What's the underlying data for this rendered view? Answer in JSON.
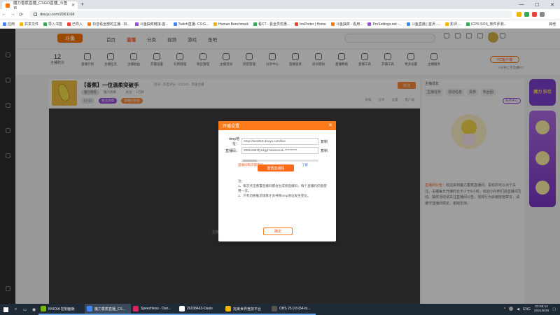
{
  "browser": {
    "tab_title": "魔力香蕉直播_CSGO直播_斗鱼直...",
    "url": "douyu.com/2061168",
    "bookmarks": [
      "应用",
      "共享文件",
      "导入书签",
      "已导入",
      "抖音看全部的主播 - 抖...",
      "斗鱼抽奖链接-首...",
      "Twitch直播- CS:G...",
      "Human Benchmark",
      "看CT - 看全员优惠...",
      "InsPorter | Home",
      "斗鱼抽奖 - 看用...",
      "ProSettings.net -...",
      "斗鱼直播 | 首页 -...",
      "影评·...",
      "ICPS SOS_软件评测..."
    ],
    "bookmarks_more": "其他"
  },
  "header": {
    "logo": "斗鱼",
    "nav": [
      "首页",
      "直播",
      "分类",
      "视频",
      "游戏",
      "鱼吧"
    ]
  },
  "toolbar": {
    "count": "12",
    "count_label": "主播积分",
    "items": [
      "直播计划",
      "主播任务",
      "主播收益",
      "开播设置",
      "礼物管理",
      "粉丝管理",
      "主播活动",
      "房管管理",
      "分享中心",
      "直播道具",
      "房间装扮",
      "直播数据",
      "直播工具",
      "开播工具",
      "更多设置",
      "主播服务"
    ],
    "pc_client": "PC客户端",
    "pc_sub": "1分钟上手直播PC"
  },
  "room": {
    "title": "【香蕉】一位温柔突破手",
    "subtitle": "房间 · 热度评分 · CS:GO · 等级主播",
    "meta": [
      "魔力香蕉",
      "·",
      "关注",
      "1万粉"
    ],
    "tags": [
      "LV 11",
      "粉丝勋章",
      "直播间等级"
    ],
    "cover_label": "魔力香蕉",
    "follow": "关注",
    "tools": [
      "举报",
      "分享",
      "设置",
      "客户端"
    ]
  },
  "player": {
    "tip": "主播正在准备中，请稍后再试"
  },
  "modal": {
    "title": "开播设置",
    "rtmp_label": "rtmp地址：",
    "rtmp_value": "rtmp://sendtc3.douyu.com/live",
    "code_label": "直播码：",
    "code_value": "2061168rxfy1dgyl?wsSecret=**********",
    "copy": "复制",
    "red_tip": "直播码每次都不同",
    "help": "了解",
    "reset": "重置直播码",
    "note": "注：\n1、每次点击重置直播码都会生成新直播码，每个直播码仅能使用一次。\n2、只有切换推流镜像才会导致rtmp地址发生变化。",
    "ok": "确定"
  },
  "right_panel": {
    "top": "主播成长",
    "tabs": [
      "主播任务",
      "活动信息",
      "贵族",
      "粉丝团"
    ],
    "button": "任务中心",
    "notice_label": "直播间公告：",
    "notice": "欢迎来到魔力香蕉直播间，喜欢的可以点个关注。主播每天开播时长不少于6小时，欢迎小伙伴们进直播间互动。抽奖活动请关注直播间公告，违规行为会被房管禁言，请遵守直播间规定，谢谢支持。"
  },
  "side_ads": {
    "ad1": "魔力 狂欢"
  },
  "taskbar": {
    "apps": [
      {
        "label": "NVIDIA 控制面板",
        "color": "#76b900"
      },
      {
        "label": "魔力香蕉直播_CS...",
        "color": "#4285f4"
      },
      {
        "label": "Speechless - Dan...",
        "color": "#e0245e"
      },
      {
        "label": "26338463-Oasis",
        "color": "#ffffff"
      },
      {
        "label": "完美世界竞技平台",
        "color": "#f4b400"
      },
      {
        "label": "OBS 25.0.8 (64-bi...",
        "color": "#555555"
      }
    ],
    "lang": "ENG",
    "time": "22:08:12",
    "date": "2021/9/26"
  }
}
